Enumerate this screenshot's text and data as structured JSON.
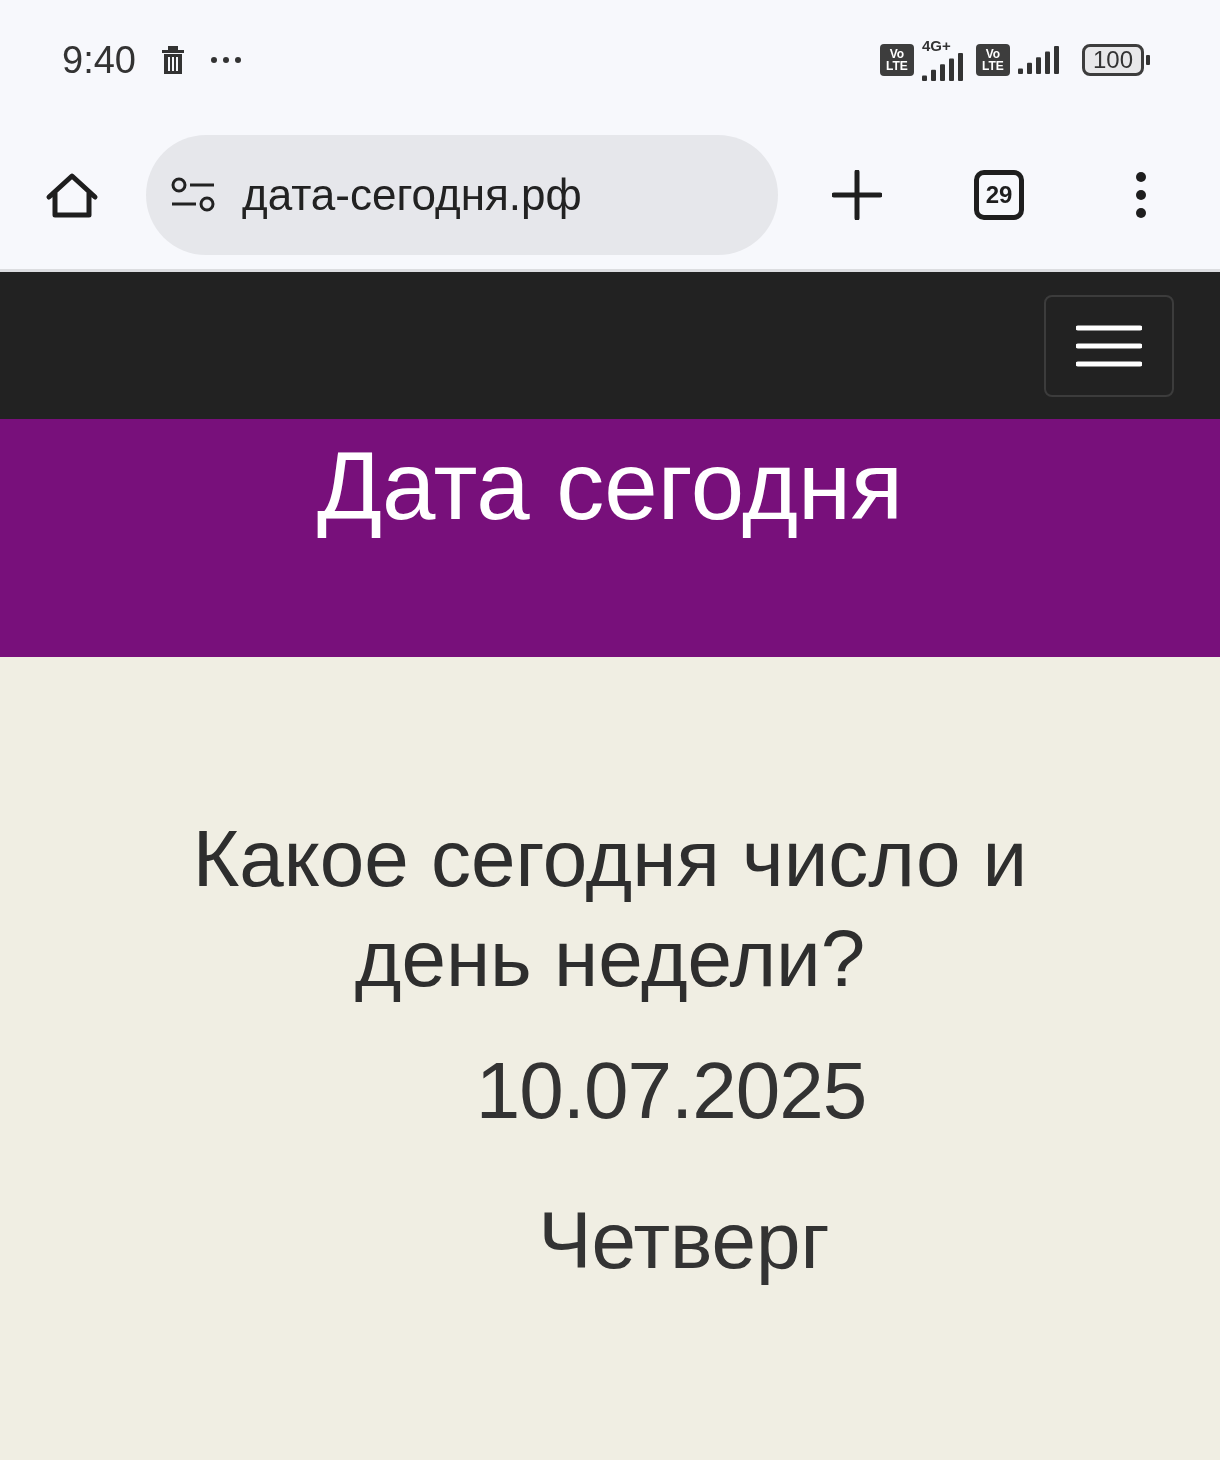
{
  "status_bar": {
    "time": "9:40",
    "network": "4G+",
    "battery": "100",
    "sim_badges": [
      {
        "top": "Vo",
        "bottom": "LTE"
      },
      {
        "top": "Vo",
        "bottom": "LTE"
      }
    ]
  },
  "browser": {
    "url": "дата-сегодня.рф",
    "tab_count": "29"
  },
  "site": {
    "title": "Дата сегодня",
    "heading": "Какое сегодня число и день недели?",
    "date": "10.07.2025",
    "weekday": "Четверг"
  }
}
